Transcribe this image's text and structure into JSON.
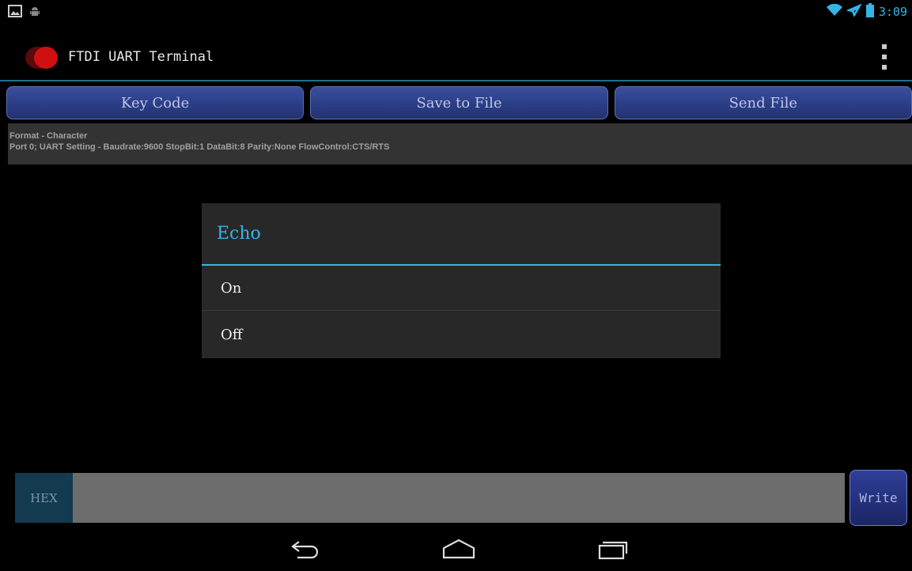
{
  "status_bar": {
    "time": "3:09",
    "icons": [
      "gallery-icon",
      "android-icon",
      "wifi-icon",
      "airplane-mode-icon",
      "battery-icon"
    ]
  },
  "action_bar": {
    "title": "FTDI UART Terminal",
    "icon": "app-icon",
    "overflow_icon": "overflow-menu-icon"
  },
  "buttons": {
    "key_code": "Key Code",
    "save_to_file": "Save to File",
    "send_file": "Send File"
  },
  "info": {
    "format": "Format - Character",
    "port_settings": "Port 0; UART Setting  -  Baudrate:9600  StopBit:1  DataBit:8  Parity:None  FlowControl:CTS/RTS"
  },
  "dialog": {
    "title": "Echo",
    "options": [
      "On",
      "Off"
    ]
  },
  "input": {
    "mode_label": "HEX",
    "value": "",
    "write_label": "Write"
  },
  "nav_bar": {
    "icons": [
      "back-icon",
      "home-icon",
      "recents-icon"
    ]
  },
  "colors": {
    "accent": "#33b5e5",
    "button": "#2b3d85",
    "dialog_bg": "#282828"
  }
}
